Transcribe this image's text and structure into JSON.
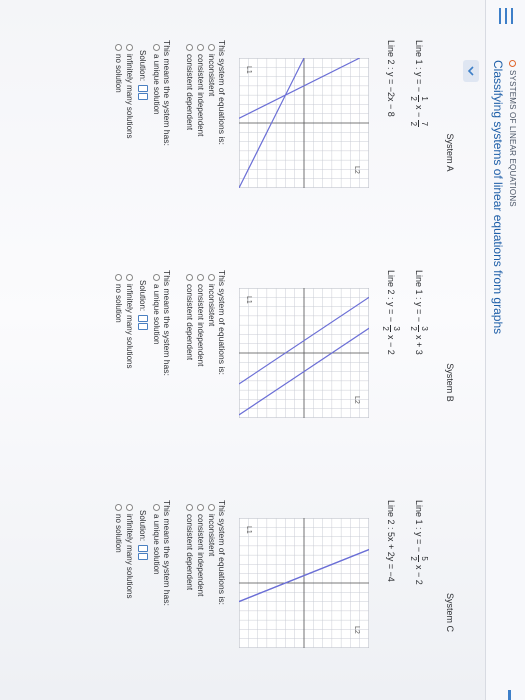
{
  "header": {
    "section": "SYSTEMS OF LINEAR EQUATIONS",
    "title": "Classifying systems of linear equations from graphs"
  },
  "systems": [
    {
      "title": "System A",
      "line1": {
        "prefix": "Line 1 : y = −",
        "num": "1",
        "den": "2",
        "mid": "x −",
        "num2": "7",
        "den2": "2"
      },
      "line2": {
        "text": "Line 2 : y = −2x − 8"
      },
      "graph_labels": {
        "l1": "L1",
        "l2": "L2"
      }
    },
    {
      "title": "System B",
      "line1": {
        "prefix": "Line 1 : y = −",
        "num": "3",
        "den": "2",
        "mid": "x + 3",
        "num2": "",
        "den2": ""
      },
      "line2": {
        "prefix": "Line 2 : y = −",
        "num": "3",
        "den": "2",
        "mid": "x − 2"
      },
      "graph_labels": {
        "l1": "L1",
        "l2": "L2"
      }
    },
    {
      "title": "System C",
      "line1": {
        "prefix": "Line 1 : y = −",
        "num": "5",
        "den": "2",
        "mid": "x − 2",
        "num2": "",
        "den2": ""
      },
      "line2": {
        "text": "Line 2 : 5x + 2y = −4"
      },
      "graph_labels": {
        "l1": "L1",
        "l2": "L2"
      }
    }
  ],
  "question": {
    "label": "This system of equations is:",
    "options": [
      "inconsistent",
      "consistent independent",
      "consistent dependent"
    ]
  },
  "means": {
    "label": "This means the system has:",
    "unique": "a unique solution",
    "solution_label": "Solution:",
    "infinite": "infinitely many solutions",
    "none": "no solution"
  },
  "colors": {
    "accent": "#3d7fc8",
    "line": "#6b6fd6",
    "grid": "#c9ccd4"
  }
}
